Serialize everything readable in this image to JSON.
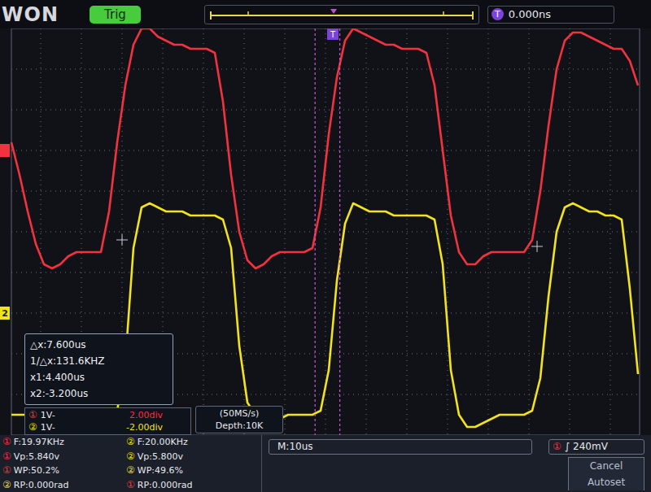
{
  "top_bar": {
    "logo": "WON",
    "status": "Trig",
    "time_offset_icon": "T",
    "time_offset": "0.000ns"
  },
  "chart": {
    "trigger_marker": "T",
    "cursor_times_us": [
      4.4,
      -3.2
    ],
    "series": [
      {
        "channel": "1",
        "color": "#f2323f",
        "marker": null,
        "values": [
          0.2,
          -0.6,
          -1.5,
          -2.3,
          -2.8,
          -2.9,
          -2.8,
          -2.6,
          -2.5,
          -2.5,
          -2.5,
          -2.5,
          -1.5,
          0.2,
          1.6,
          2.6,
          3.0,
          3.0,
          2.8,
          2.7,
          2.6,
          2.6,
          2.5,
          2.5,
          2.5,
          2.4,
          1.2,
          -0.6,
          -2.0,
          -2.7,
          -2.9,
          -2.8,
          -2.6,
          -2.5,
          -2.5,
          -2.5,
          -2.5,
          -2.4,
          -1.4,
          0.4,
          1.8,
          2.7,
          3.0,
          2.9,
          2.8,
          2.7,
          2.6,
          2.6,
          2.5,
          2.5,
          2.5,
          2.4,
          1.6,
          0.0,
          -1.6,
          -2.5,
          -2.8,
          -2.8,
          -2.6,
          -2.5,
          -2.5,
          -2.5,
          -2.5,
          -2.5,
          -2.2,
          -1.0,
          0.6,
          2.0,
          2.7,
          2.9,
          2.9,
          2.8,
          2.7,
          2.6,
          2.5,
          2.5,
          2.2,
          1.6
        ]
      },
      {
        "channel": "2",
        "color": "#f2e31a",
        "marker": "2",
        "values": [
          -2.5,
          -2.5,
          -2.5,
          -2.5,
          -2.5,
          -2.5,
          -2.5,
          -2.5,
          -2.5,
          -2.5,
          -2.5,
          -2.5,
          -2.5,
          -2.4,
          -1.2,
          1.6,
          2.6,
          2.7,
          2.6,
          2.5,
          2.5,
          2.5,
          2.4,
          2.4,
          2.4,
          2.4,
          2.3,
          1.6,
          -0.8,
          -2.2,
          -2.5,
          -2.6,
          -2.6,
          -2.6,
          -2.5,
          -2.5,
          -2.5,
          -2.5,
          -2.4,
          -1.4,
          0.8,
          2.2,
          2.7,
          2.6,
          2.5,
          2.5,
          2.5,
          2.4,
          2.4,
          2.4,
          2.4,
          2.4,
          2.3,
          1.2,
          -1.4,
          -2.5,
          -2.8,
          -2.8,
          -2.7,
          -2.6,
          -2.5,
          -2.5,
          -2.5,
          -2.5,
          -2.4,
          -1.6,
          0.4,
          2.0,
          2.6,
          2.7,
          2.6,
          2.5,
          2.5,
          2.4,
          2.4,
          2.3,
          0.6,
          -1.5
        ]
      }
    ]
  },
  "readout": [
    "△x:7.600us",
    "1/△x:131.6KHZ",
    "x1:4.400us",
    "x2:-3.200us"
  ],
  "channel_scales": [
    {
      "badge": "①",
      "scale": "1V-",
      "offset": "2.00div",
      "color": "#f2323f"
    },
    {
      "badge": "②",
      "scale": "1V-",
      "offset": "-2.00div",
      "color": "#f2e31a"
    }
  ],
  "acquisition": {
    "sample_rate": "(50MS/s)",
    "depth": "Depth:10K"
  },
  "measurements": [
    {
      "badge": "①",
      "text": "F:19.97KHz",
      "color": "#f2323f"
    },
    {
      "badge": "②",
      "text": "F:20.00KHz",
      "color": "#f2e31a"
    },
    {
      "badge": "①",
      "text": "Vp:5.840v",
      "color": "#f2323f"
    },
    {
      "badge": "②",
      "text": "Vp:5.800v",
      "color": "#f2e31a"
    },
    {
      "badge": "①",
      "text": "WP:50.2%",
      "color": "#f2323f"
    },
    {
      "badge": "②",
      "text": "WP:49.6%",
      "color": "#f2e31a"
    },
    {
      "badge": "②",
      "text": "RP:0.000rad",
      "color": "#f2e31a"
    },
    {
      "badge": "①",
      "text": "RP:0.000rad",
      "color": "#f2323f"
    }
  ],
  "timebase": "M:10us",
  "trigger": {
    "badge": "①",
    "edge_icon": "∫",
    "level": "240mV",
    "color": "#f2323f"
  },
  "buttons": [
    "Cancel",
    "Autoset"
  ]
}
